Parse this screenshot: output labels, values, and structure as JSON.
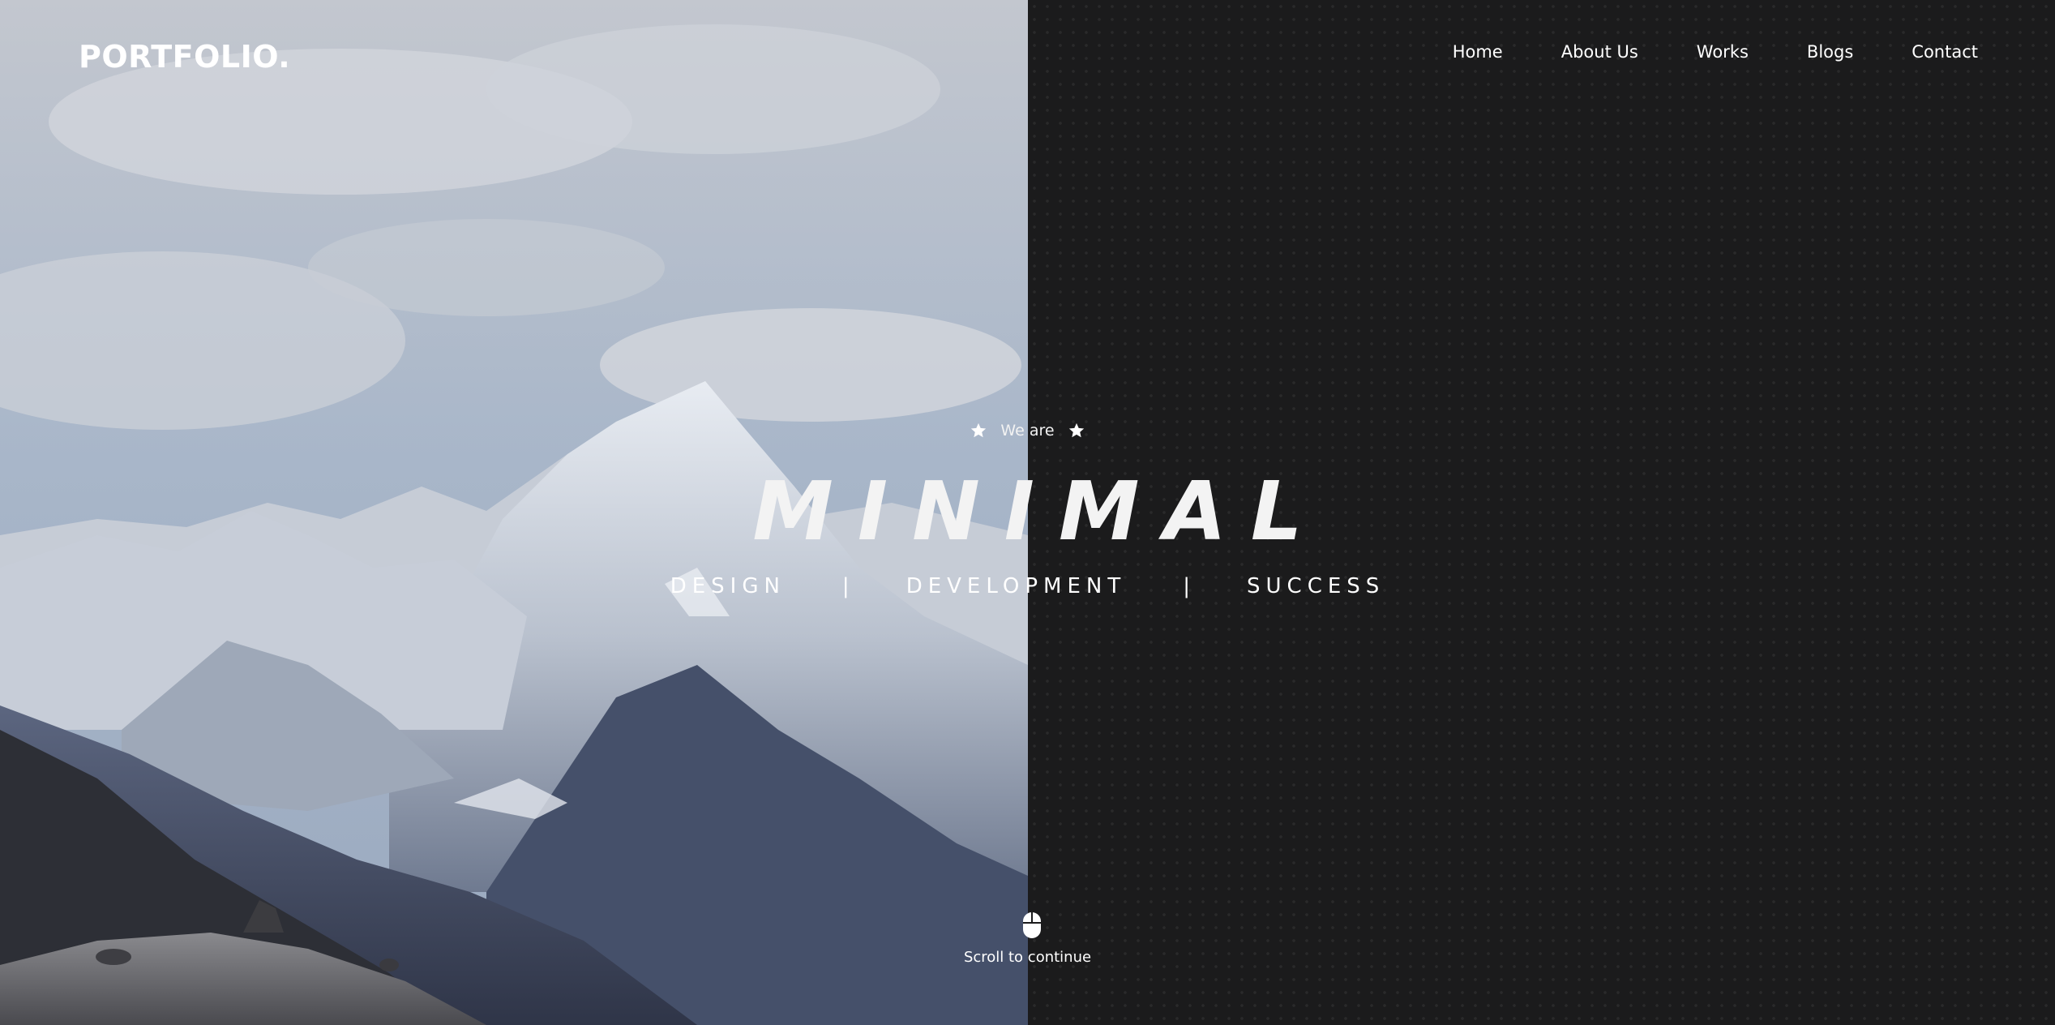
{
  "header": {
    "logo": "PORTFOLIO.",
    "nav": [
      "Home",
      "About Us",
      "Works",
      "Blogs",
      "Contact"
    ]
  },
  "hero": {
    "intro": "We are",
    "title": "MINIMAL",
    "tagline": [
      "DESIGN",
      "|",
      "DEVELOPMENT",
      "|",
      "SUCCESS"
    ],
    "icons": [
      "star-icon",
      "star-icon"
    ]
  },
  "scroll": {
    "label": "Scroll to continue",
    "icon": "mouse-icon"
  },
  "colors": {
    "right_background": "#1b1b1c",
    "text": "#ffffff",
    "title": "#f3f3f3"
  }
}
